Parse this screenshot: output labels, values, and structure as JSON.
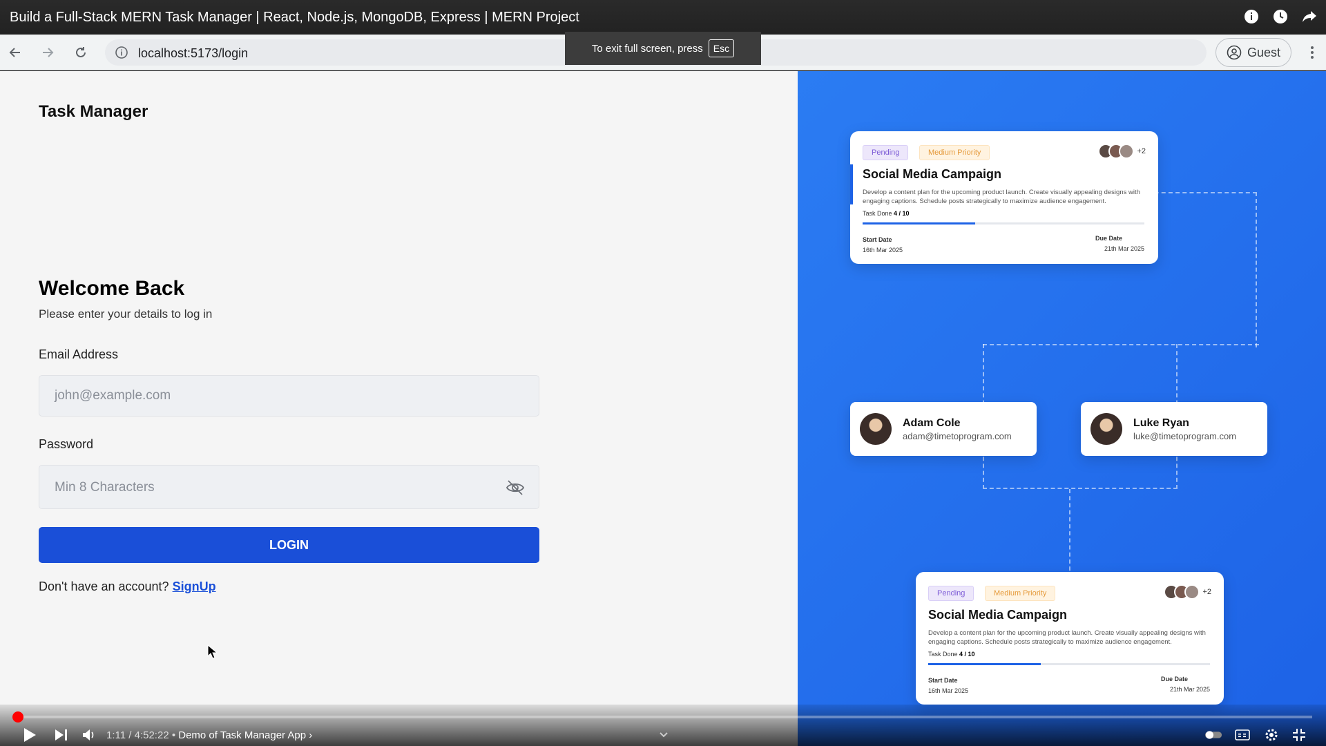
{
  "video": {
    "title": "Build a Full-Stack MERN Task Manager | React, Node.js, MongoDB, Express | MERN Project",
    "time_current": "1:11",
    "time_total": "4:52:22",
    "chapter": "Demo of Task Manager App",
    "progress_fraction": 0.004
  },
  "browser": {
    "url": "localhost:5173/login",
    "profile_label": "Guest",
    "fullscreen_toast": "To exit full screen, press",
    "esc_key": "Esc"
  },
  "login": {
    "brand": "Task Manager",
    "heading": "Welcome Back",
    "subheading": "Please enter your details to log in",
    "email_label": "Email Address",
    "email_placeholder": "john@example.com",
    "password_label": "Password",
    "password_placeholder": "Min 8 Characters",
    "login_button": "LOGIN",
    "signup_prompt": "Don't have an account?",
    "signup_link": "SignUp"
  },
  "cards": [
    {
      "status": "Pending",
      "priority": "Medium Priority",
      "extra_assignees": "+2",
      "title": "Social Media Campaign",
      "description": "Develop a content plan for the upcoming product launch. Create visually appealing designs with engaging captions. Schedule posts strategically to maximize audience engagement.",
      "task_done_label": "Task Done",
      "task_done_value": "4 / 10",
      "task_done_fraction": 0.4,
      "start_label": "Start Date",
      "start_value": "16th Mar 2025",
      "due_label": "Due Date",
      "due_value": "21th Mar 2025"
    },
    {
      "status": "Pending",
      "priority": "Medium Priority",
      "extra_assignees": "+2",
      "title": "Social Media Campaign",
      "description": "Develop a content plan for the upcoming product launch. Create visually appealing designs with engaging captions. Schedule posts strategically to maximize audience engagement.",
      "task_done_label": "Task Done",
      "task_done_value": "4 / 10",
      "task_done_fraction": 0.4,
      "start_label": "Start Date",
      "start_value": "16th Mar 2025",
      "due_label": "Due Date",
      "due_value": "21th Mar 2025"
    }
  ],
  "users": [
    {
      "name": "Adam Cole",
      "email": "adam@timetoprogram.com"
    },
    {
      "name": "Luke Ryan",
      "email": "luke@timetoprogram.com"
    }
  ],
  "colors": {
    "primary": "#1a4fd8",
    "panel": "#2b7cf3",
    "progress_red": "#ff0000"
  }
}
